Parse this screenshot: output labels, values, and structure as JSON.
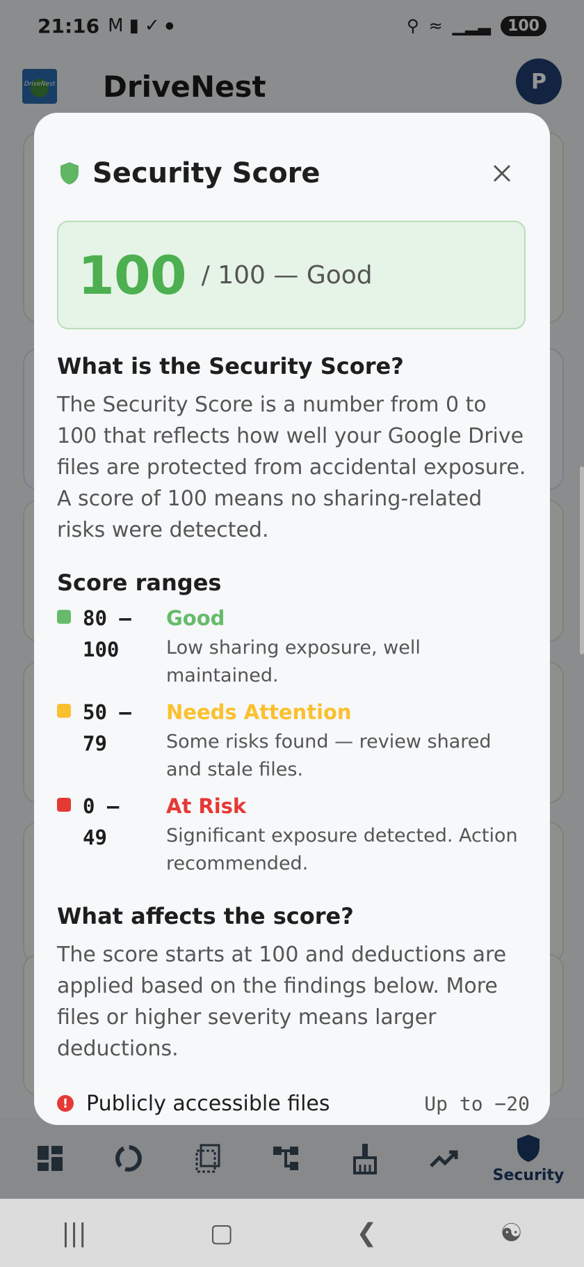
{
  "status_bar": {
    "time": "21:16",
    "icons": [
      "gmail-icon",
      "bag-icon",
      "check-circle-icon",
      "dot-icon"
    ],
    "right_icons": [
      "key-icon",
      "wifi-icon",
      "signal-icon"
    ],
    "battery": "100"
  },
  "app": {
    "title": "DriveNest",
    "logo_text": "DriveNest",
    "avatar_initial": "P"
  },
  "bottom_nav": {
    "items": [
      {
        "icon": "dashboard-icon",
        "label": ""
      },
      {
        "icon": "activity-icon",
        "label": ""
      },
      {
        "icon": "files-icon",
        "label": ""
      },
      {
        "icon": "sharing-tree-icon",
        "label": ""
      },
      {
        "icon": "broom-icon",
        "label": ""
      },
      {
        "icon": "trend-icon",
        "label": ""
      },
      {
        "icon": "shield-icon",
        "label": "Security"
      }
    ]
  },
  "dialog": {
    "title": "Security Score",
    "score": "100",
    "score_rest": "/ 100  —  Good",
    "what_title": "What is the Security Score?",
    "what_text": "The Security Score is a number from 0 to 100 that reflects how well your Google Drive files are protected from accidental exposure. A score of 100 means no sharing-related risks were detected.",
    "ranges_title": "Score ranges",
    "ranges": [
      {
        "range": "80 –\n100",
        "label": "Good",
        "desc": "Low sharing exposure, well maintained.",
        "color": "#66bb6a"
      },
      {
        "range": "50 –\n79",
        "label": "Needs Attention",
        "desc": "Some risks found — review shared and stale files.",
        "color": "#fbc02d"
      },
      {
        "range": "0 –\n49",
        "label": "At Risk",
        "desc": "Significant exposure detected. Action recommended.",
        "color": "#e53935"
      }
    ],
    "affects_title": "What affects the score?",
    "affects_text": "The score starts at 100 and deductions are applied based on the findings below. More files or higher severity means larger deductions.",
    "finding": {
      "label": "Publicly accessible files",
      "value": "Up to −20"
    }
  }
}
